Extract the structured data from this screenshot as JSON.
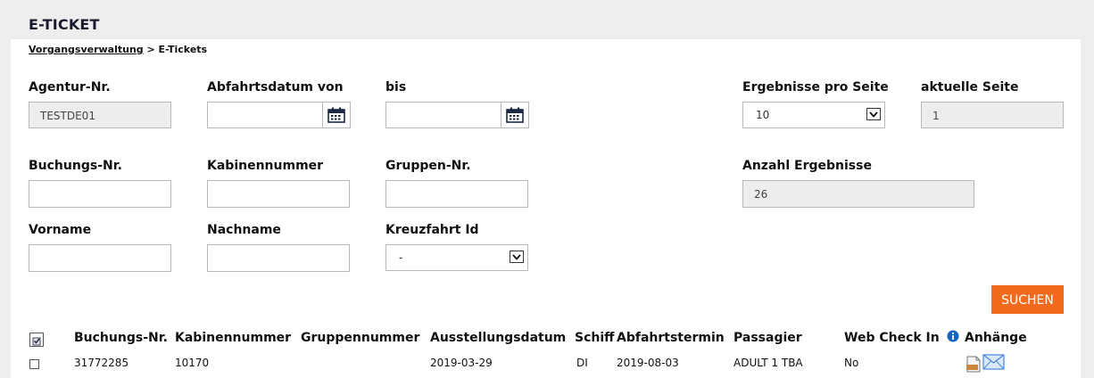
{
  "page": {
    "title": "E-TICKET"
  },
  "breadcrumb": {
    "link": "Vorgangsverwaltung",
    "separator": " > ",
    "current": "E-Tickets"
  },
  "form": {
    "agentur": {
      "label": "Agentur-Nr.",
      "value": "TESTDE01"
    },
    "abfahrt_von": {
      "label": "Abfahrtsdatum von",
      "value": ""
    },
    "abfahrt_bis": {
      "label": "bis",
      "value": ""
    },
    "ergebnisse_pro_seite": {
      "label": "Ergebnisse pro Seite",
      "value": "10"
    },
    "aktuelle_seite": {
      "label": "aktuelle Seite",
      "value": "1"
    },
    "buchungs_nr": {
      "label": "Buchungs-Nr.",
      "value": ""
    },
    "kabinennummer": {
      "label": "Kabinennummer",
      "value": ""
    },
    "gruppen_nr": {
      "label": "Gruppen-Nr.",
      "value": ""
    },
    "anzahl_ergebnisse": {
      "label": "Anzahl Ergebnisse",
      "value": "26"
    },
    "vorname": {
      "label": "Vorname",
      "value": ""
    },
    "nachname": {
      "label": "Nachname",
      "value": ""
    },
    "kreuzfahrt_id": {
      "label": "Kreuzfahrt Id",
      "value": "-"
    },
    "search_button": "SUCHEN"
  },
  "table": {
    "headers": {
      "buchungs_nr": "Buchungs-Nr.",
      "kabinennummer": "Kabinennummer",
      "gruppennummer": "Gruppennummer",
      "ausstellungsdatum": "Ausstellungsdatum",
      "schiff": "Schiff",
      "abfahrtstermin": "Abfahrtstermin",
      "passagier": "Passagier",
      "web_check_in": "Web Check In",
      "anhaenge": "Anhänge"
    },
    "rows": [
      {
        "buchungs_nr": "31772285",
        "kabinennummer": "10170",
        "gruppennummer": "",
        "ausstellungsdatum": "2019-03-29",
        "schiff": "DI",
        "abfahrtstermin": "2019-08-03",
        "passagier": "ADULT 1 TBA",
        "web_check_in": "No"
      }
    ]
  },
  "icons": {
    "calendar": "calendar-icon",
    "dropdown": "chevron-down-icon",
    "info": "info-icon",
    "zip": "zip-file-icon",
    "mail": "envelope-icon",
    "select_all": "select-all-icon"
  },
  "colors": {
    "accent": "#f26b1d",
    "info": "#1565c0"
  }
}
